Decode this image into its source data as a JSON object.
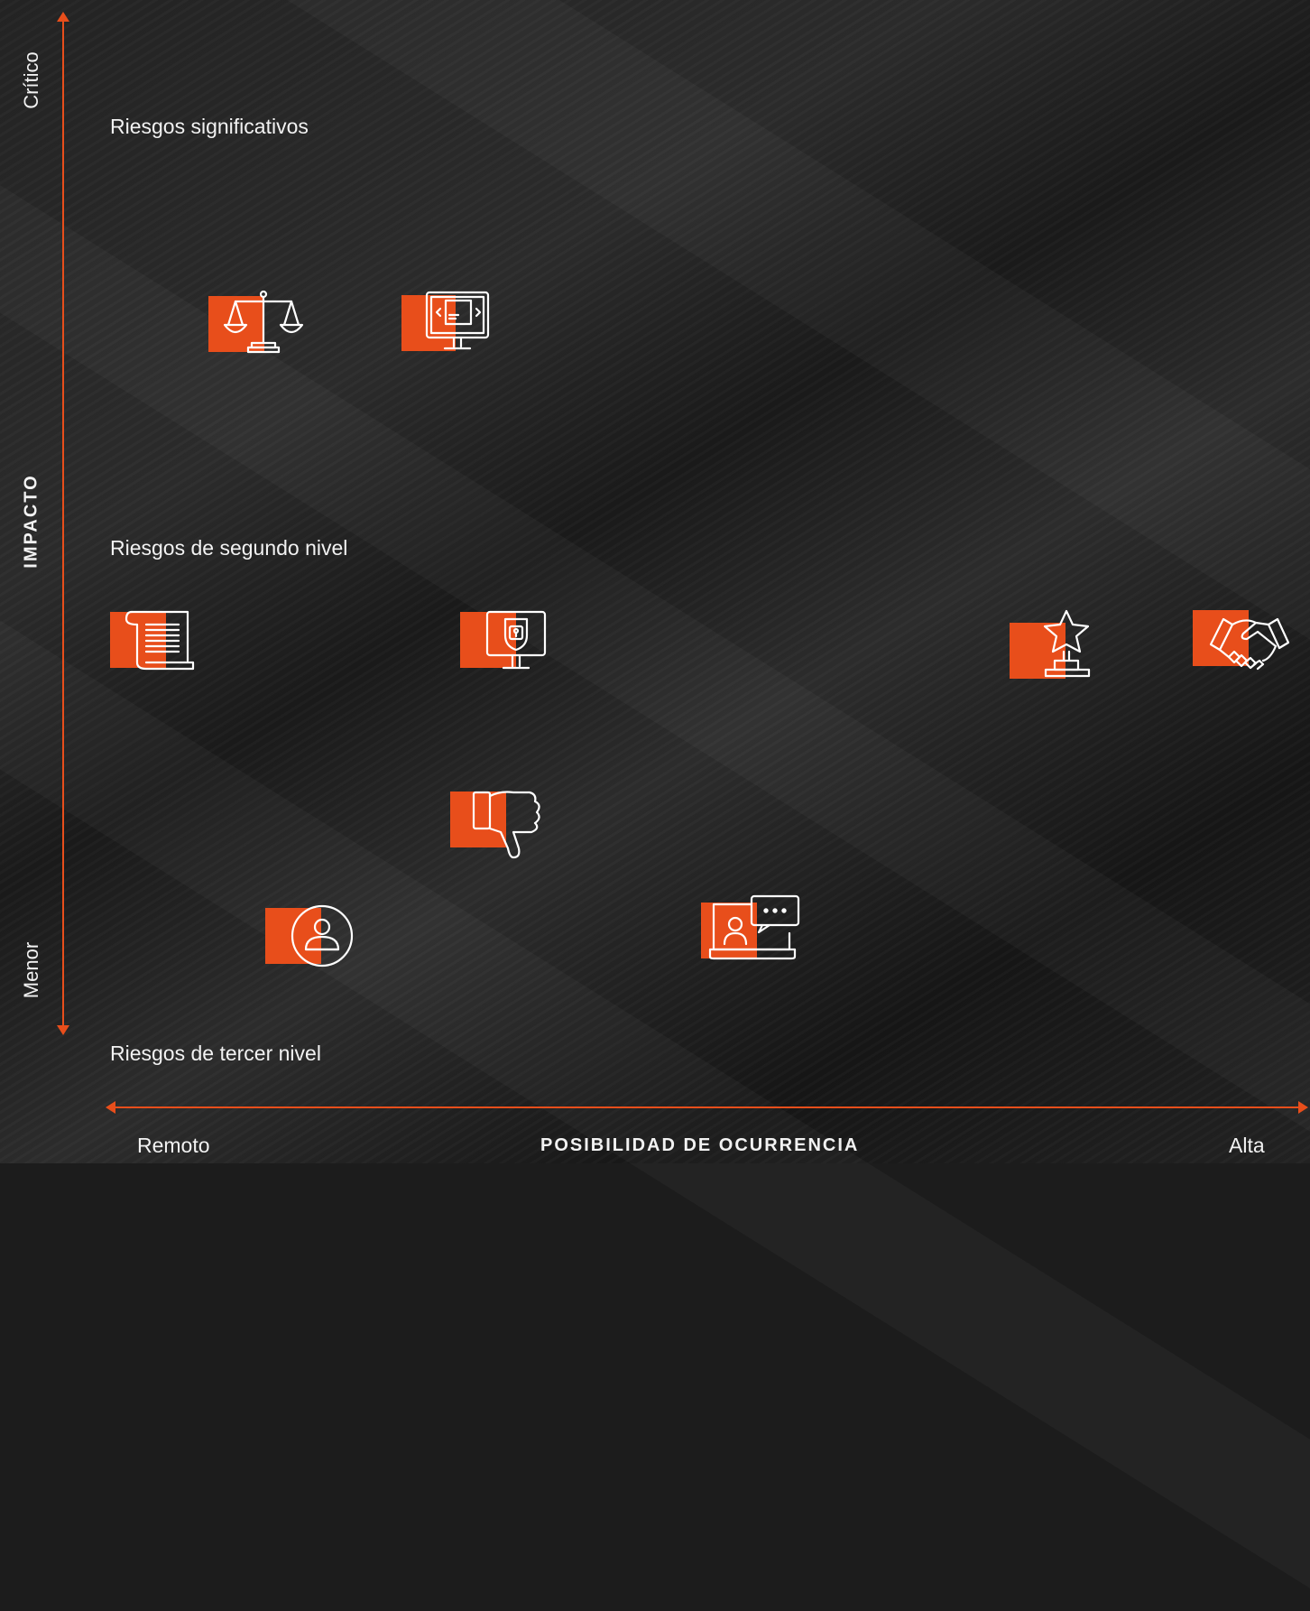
{
  "colors": {
    "accent": "#e84e1b",
    "background": "#1c1c1c",
    "text": "#ffffff"
  },
  "y_axis": {
    "title": "IMPACTO",
    "top_label": "Crítico",
    "bottom_label": "Menor"
  },
  "x_axis": {
    "title": "POSIBILIDAD DE OCURRENCIA",
    "left_label": "Remoto",
    "right_label": "Alta"
  },
  "zones": {
    "significant": "Riesgos significativos",
    "second": "Riesgos de segundo nivel",
    "third": "Riesgos de tercer nivel"
  },
  "icons": [
    "scales-icon",
    "monitor-code-icon",
    "scroll-document-icon",
    "monitor-lock-icon",
    "trophy-star-icon",
    "handshake-icon",
    "thumbs-down-icon",
    "user-circle-icon",
    "laptop-chat-icon"
  ]
}
